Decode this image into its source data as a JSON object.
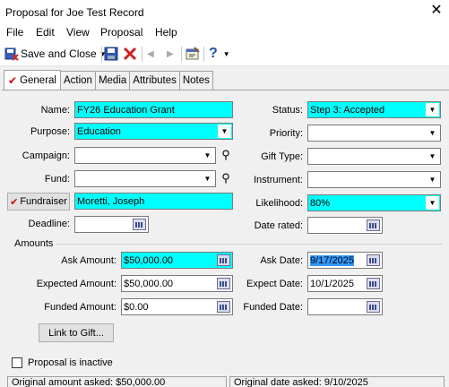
{
  "window": {
    "title": "Proposal for Joe Test Record",
    "close_glyph": "✕"
  },
  "menu": [
    "File",
    "Edit",
    "View",
    "Proposal",
    "Help"
  ],
  "toolbar": {
    "save_close": "Save and Close"
  },
  "tabs": [
    "General",
    "Action",
    "Media",
    "Attributes",
    "Notes"
  ],
  "left": {
    "name_label": "Name:",
    "name_value": "FY26 Education Grant",
    "purpose_label": "Purpose:",
    "purpose_value": "Education",
    "campaign_label": "Campaign:",
    "campaign_value": "",
    "fund_label": "Fund:",
    "fund_value": "",
    "fundraiser_button": "Fundraiser",
    "fundraiser_value": "Moretti, Joseph",
    "deadline_label": "Deadline:",
    "deadline_value": ""
  },
  "right": {
    "status_label": "Status:",
    "status_value": "Step 3: Accepted",
    "priority_label": "Priority:",
    "priority_value": "",
    "gift_type_label": "Gift Type:",
    "gift_type_value": "",
    "instrument_label": "Instrument:",
    "instrument_value": "",
    "likelihood_label": "Likelihood:",
    "likelihood_value": "80%",
    "date_rated_label": "Date rated:",
    "date_rated_value": ""
  },
  "amounts": {
    "group_label": "Amounts",
    "ask_amount_label": "Ask Amount:",
    "ask_amount_value": "$50,000.00",
    "expected_amount_label": "Expected Amount:",
    "expected_amount_value": "$50,000.00",
    "funded_amount_label": "Funded Amount:",
    "funded_amount_value": "$0.00",
    "ask_date_label": "Ask Date:",
    "ask_date_value": "9/17/2025",
    "expect_date_label": "Expect Date:",
    "expect_date_value": "10/1/2025",
    "funded_date_label": "Funded Date:",
    "funded_date_value": ""
  },
  "link_button": "Link to Gift...",
  "inactive_label": "Proposal is inactive",
  "statusbar": {
    "left": "Original amount asked: $50,000.00",
    "right": "Original date asked: 9/10/2025"
  },
  "colors": {
    "required_field": "#00ffff",
    "panel": "#f0f0f0",
    "checkmark": "#d40000"
  }
}
